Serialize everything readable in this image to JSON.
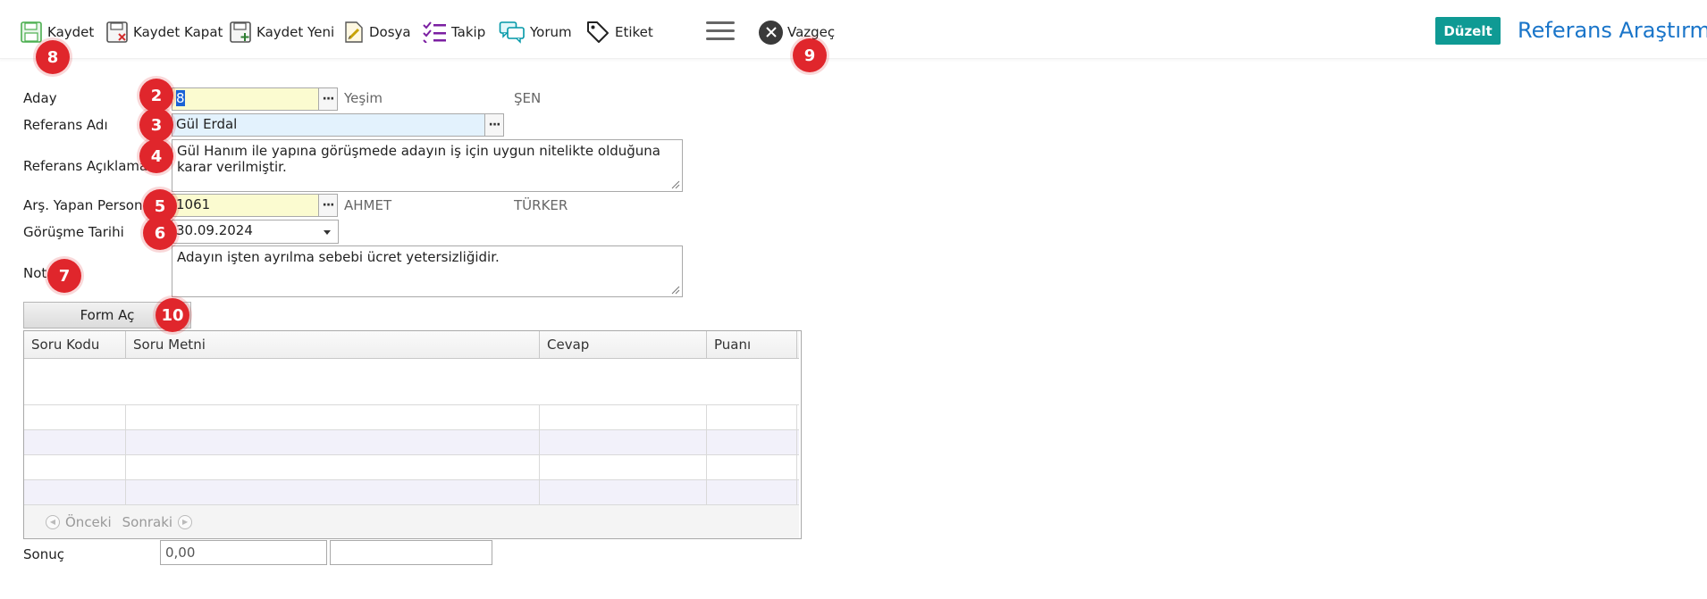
{
  "toolbar": {
    "save_label": "Kaydet",
    "save_close_label": "Kaydet Kapat",
    "save_new_label": "Kaydet Yeni",
    "file_label": "Dosya",
    "follow_label": "Takip",
    "comment_label": "Yorum",
    "tag_label": "Etiket",
    "cancel_label": "Vazgeç",
    "edit_label": "Düzelt"
  },
  "page_title": "Referans Araştırması",
  "badges": {
    "b2": "2",
    "b3": "3",
    "b4": "4",
    "b5": "5",
    "b6": "6",
    "b7": "7",
    "b8": "8",
    "b9": "9",
    "b10": "10"
  },
  "form": {
    "aday": {
      "label": "Aday",
      "value": "8",
      "first_name": "Yeşim",
      "last_name": "ŞEN"
    },
    "referans_adi": {
      "label": "Referans Adı",
      "value": "Gül Erdal"
    },
    "referans_aciklama": {
      "label": "Referans Açıklama",
      "value": "Gül Hanım ile yapına görüşmede adayın iş için uygun nitelikte olduğuna karar verilmiştir."
    },
    "ars_yapan_personel": {
      "label": "Arş. Yapan Personel",
      "value": "1061",
      "first_name": "AHMET",
      "last_name": "TÜRKER"
    },
    "gorusme_tarihi": {
      "label": "Görüşme Tarihi",
      "value": "30.09.2024"
    },
    "not": {
      "label": "Not",
      "value": "Adayın işten ayrılma sebebi ücret yetersizliğidir."
    },
    "form_ac_label": "Form Aç",
    "sonuc": {
      "label": "Sonuç",
      "value": "0,00",
      "extra": ""
    }
  },
  "grid": {
    "columns": [
      "Soru Kodu",
      "Soru Metni",
      "Cevap",
      "Puanı"
    ],
    "rows": [
      [
        "",
        "",
        "",
        ""
      ],
      [
        "",
        "",
        "",
        ""
      ],
      [
        "",
        "",
        "",
        ""
      ],
      [
        "",
        "",
        "",
        ""
      ]
    ],
    "prev_label": "Önceki",
    "next_label": "Sonraki"
  },
  "colors": {
    "accent": "#0f9a94",
    "title": "#1a75c9",
    "badge": "#e0262c",
    "required_field": "#fbfbd0",
    "focused_field": "#e3f2fd"
  }
}
